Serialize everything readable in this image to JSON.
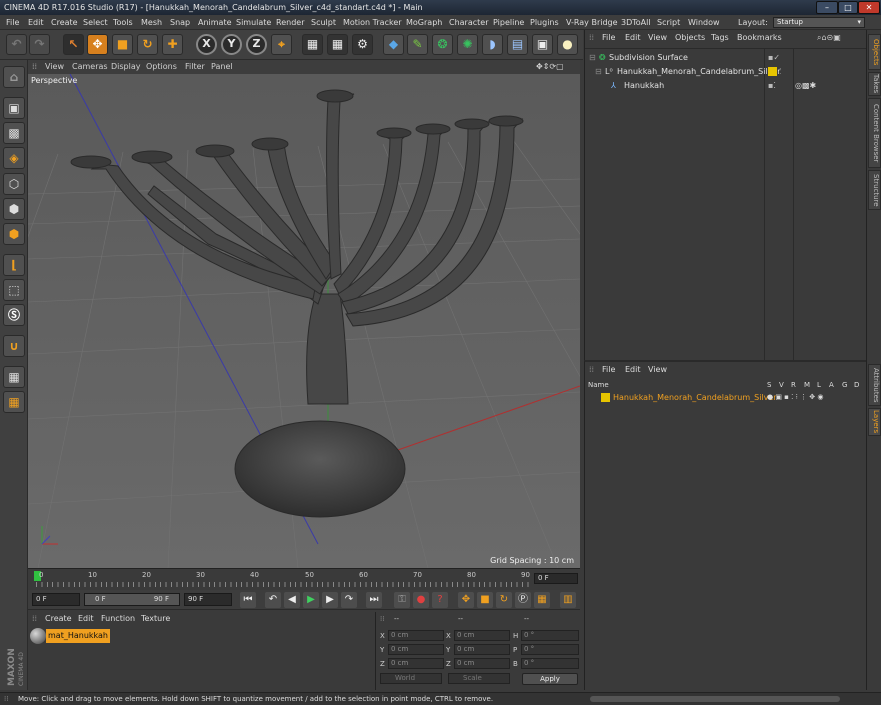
{
  "titlebar": {
    "title": "CINEMA 4D R17.016 Studio (R17) - [Hanukkah_Menorah_Candelabrum_Silver_c4d_standart.c4d *] - Main"
  },
  "menubar": {
    "items": [
      "File",
      "Edit",
      "Create",
      "Select",
      "Tools",
      "Mesh",
      "Snap",
      "Animate",
      "Simulate",
      "Render",
      "Sculpt",
      "Motion Tracker",
      "MoGraph",
      "Character",
      "Pipeline",
      "Plugins",
      "V-Ray Bridge",
      "3DToAll",
      "Script",
      "Window"
    ],
    "layout_label": "Layout:",
    "layout_value": "Startup"
  },
  "toolbar": {
    "axis_x": "X",
    "axis_y": "Y",
    "axis_z": "Z"
  },
  "viewport": {
    "menu": [
      "View",
      "Cameras",
      "Display",
      "Options",
      "Filter",
      "Panel"
    ],
    "camera_label": "Perspective",
    "grid_spacing": "Grid Spacing : 10 cm"
  },
  "timeline": {
    "ticks": [
      "0",
      "10",
      "20",
      "30",
      "40",
      "50",
      "60",
      "70",
      "80",
      "90"
    ],
    "current_frame": "0 F"
  },
  "transport": {
    "start_frame": "0 F",
    "range_start": "0 F",
    "range_end": "90 F",
    "end_frame": "90 F"
  },
  "material_manager": {
    "menu": [
      "Create",
      "Edit",
      "Function",
      "Texture"
    ],
    "material_name": "mat_Hanukkah"
  },
  "coordinates": {
    "header_dashes": [
      "--",
      "--",
      "--"
    ],
    "rows": [
      {
        "a": "X",
        "av": "0 cm",
        "b": "X",
        "bv": "0 cm",
        "c": "H",
        "cv": "0 °"
      },
      {
        "a": "Y",
        "av": "0 cm",
        "b": "Y",
        "bv": "0 cm",
        "c": "P",
        "cv": "0 °"
      },
      {
        "a": "Z",
        "av": "0 cm",
        "b": "Z",
        "bv": "0 cm",
        "c": "B",
        "cv": "0 °"
      }
    ],
    "mode_world": "World",
    "mode_scale": "Scale",
    "apply_label": "Apply"
  },
  "objects_panel": {
    "menu": [
      "File",
      "Edit",
      "View",
      "Objects",
      "Tags",
      "Bookmarks"
    ],
    "objects": [
      "Subdivision Surface",
      "Hanukkah_Menorah_Candelabrum_Silver",
      "Hanukkah"
    ]
  },
  "layers_panel": {
    "menu": [
      "File",
      "Edit",
      "View"
    ],
    "columns": [
      "Name",
      "S",
      "V",
      "R",
      "M",
      "L",
      "A",
      "G",
      "D"
    ],
    "layer_name": "Hanukkah_Menorah_Candelabrum_Silver"
  },
  "right_tabs": [
    "Objects",
    "Takes",
    "Content Browser",
    "Structure",
    "Attributes",
    "Layers"
  ],
  "branding": {
    "maxon": "MAXON",
    "product": "CINEMA 4D"
  },
  "status": {
    "text": "Move: Click and drag to move elements. Hold down SHIFT to quantize movement / add to the selection in point mode, CTRL to remove."
  },
  "colors": {
    "selection_orange": "#f0a020",
    "layer_yellow": "#e6c400",
    "viewport_bg": "#5e5e5e"
  }
}
